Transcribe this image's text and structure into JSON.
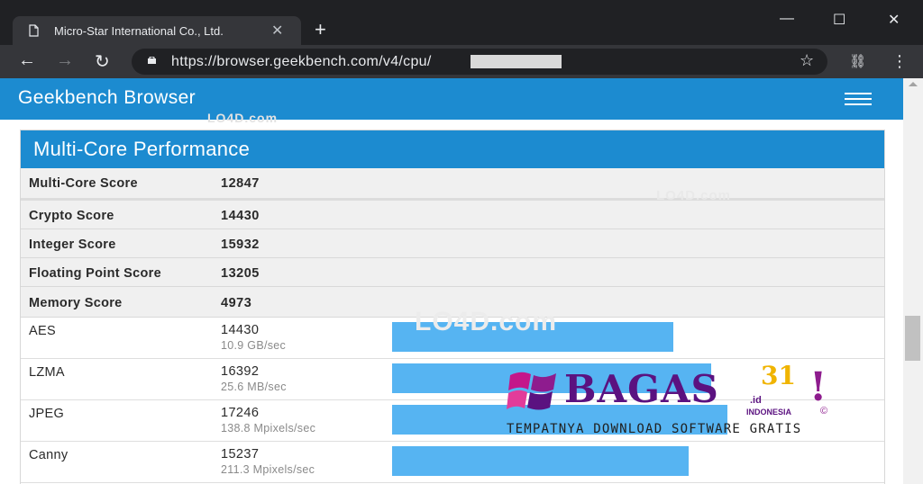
{
  "browser": {
    "tab_title": "Micro-Star International Co., Ltd.",
    "tab_close_glyph": "✕",
    "new_tab_glyph": "+",
    "url": "https://browser.geekbench.com/v4/cpu/",
    "window_buttons": {
      "minimize": "—",
      "maximize": "☐",
      "close": "✕"
    },
    "nav": {
      "back": "←",
      "forward": "→",
      "reload": "↻"
    },
    "icons": {
      "bookmark": "☆",
      "incognito": "⛓",
      "menu": "⋮"
    }
  },
  "site": {
    "title": "Geekbench Browser",
    "accent_color": "#1c8bd0"
  },
  "panel": {
    "title": "Multi-Core Performance",
    "scores": [
      {
        "label": "Multi-Core Score",
        "value": "12847"
      },
      {
        "label": "Crypto Score",
        "value": "14430"
      },
      {
        "label": "Integer Score",
        "value": "15932"
      },
      {
        "label": "Floating Point Score",
        "value": "13205"
      },
      {
        "label": "Memory Score",
        "value": "4973"
      }
    ],
    "workloads": [
      {
        "label": "AES",
        "score": "14430",
        "rate": "10.9 GB/sec",
        "bar_value": 14430
      },
      {
        "label": "LZMA",
        "score": "16392",
        "rate": "25.6 MB/sec",
        "bar_value": 16392
      },
      {
        "label": "JPEG",
        "score": "17246",
        "rate": "138.8 Mpixels/sec",
        "bar_value": 17246
      },
      {
        "label": "Canny",
        "score": "15237",
        "rate": "211.3 Mpixels/sec",
        "bar_value": 15237
      }
    ],
    "bar_color": "#56b4f2",
    "bar_scale_max": 23900
  },
  "watermarks": {
    "lo4d": "LO4D.com",
    "bagas_word": "BAGAS",
    "bagas_number": "31",
    "bagas_tld": ".id",
    "bagas_exclaim": "!",
    "bagas_country": "INDONESIA",
    "bagas_copyright": "©",
    "bagas_tagline": "TEMPATNYA DOWNLOAD SOFTWARE GRATIS"
  }
}
